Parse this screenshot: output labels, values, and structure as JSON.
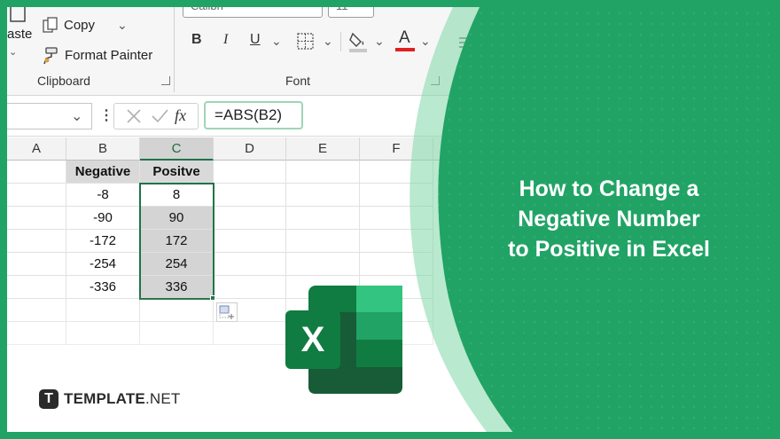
{
  "ribbon": {
    "paste_label": "aste",
    "copy_label": "Copy",
    "format_painter_label": "Format Painter",
    "clipboard_group": "Clipboard",
    "font_name": "Calibri",
    "font_size": "11",
    "font_group": "Font",
    "bold": "B",
    "italic": "I",
    "underline": "U",
    "font_color_glyph": "A"
  },
  "formula_bar": {
    "fx": "fx",
    "formula": "=ABS(B2)"
  },
  "sheet": {
    "columns": [
      "A",
      "B",
      "C",
      "D",
      "E",
      "F"
    ],
    "selected_column": "C",
    "header_row": [
      "",
      "Negative",
      "Positve"
    ],
    "rows": [
      [
        "",
        "-8",
        "8"
      ],
      [
        "",
        "-90",
        "90"
      ],
      [
        "",
        "-172",
        "172"
      ],
      [
        "",
        "-254",
        "254"
      ],
      [
        "",
        "-336",
        "336"
      ]
    ]
  },
  "headline": {
    "line1": "How to Change a",
    "line2": "Negative Number",
    "line3": "to Positive in Excel"
  },
  "logo": {
    "mark": "T",
    "brand": "TEMPLATE",
    "suffix": ".NET"
  },
  "excel_icon": {
    "letter": "X"
  },
  "colors": {
    "brand_green": "#21a366",
    "excel_dark": "#185c37",
    "excel_mid": "#21a366",
    "excel_light": "#33c481",
    "selection_green": "#217346"
  }
}
